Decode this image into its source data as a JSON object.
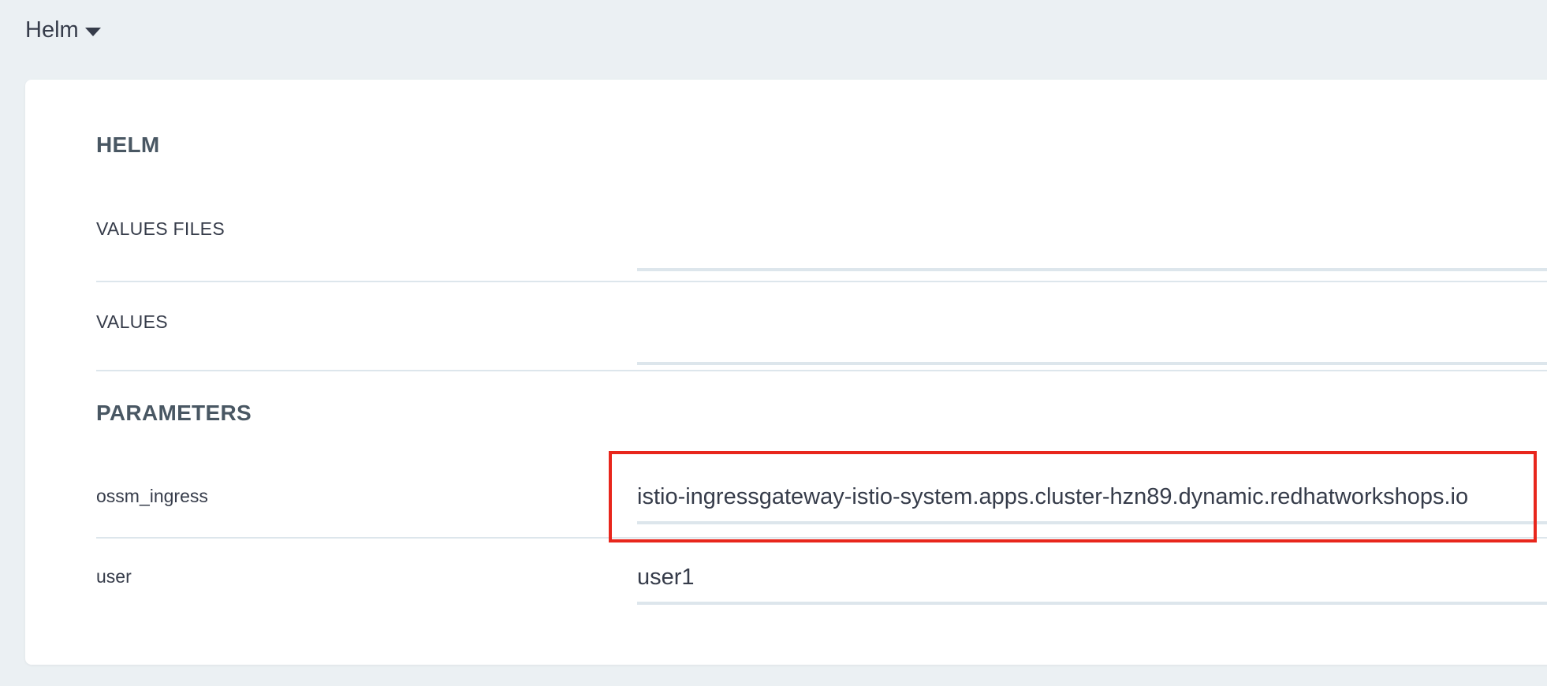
{
  "section": {
    "title": "Helm"
  },
  "helm": {
    "heading": "HELM",
    "values_files": {
      "label": "VALUES FILES",
      "value": ""
    },
    "values": {
      "label": "VALUES",
      "value": ""
    }
  },
  "parameters": {
    "heading": "PARAMETERS",
    "items": [
      {
        "name": "ossm_ingress",
        "value": "istio-ingressgateway-istio-system.apps.cluster-hzn89.dynamic.redhatworkshops.io"
      },
      {
        "name": "user",
        "value": "user1"
      }
    ]
  },
  "colors": {
    "background": "#ebf0f3",
    "panel": "#ffffff",
    "highlight": "#e8261c",
    "divider": "#dde6ec"
  }
}
